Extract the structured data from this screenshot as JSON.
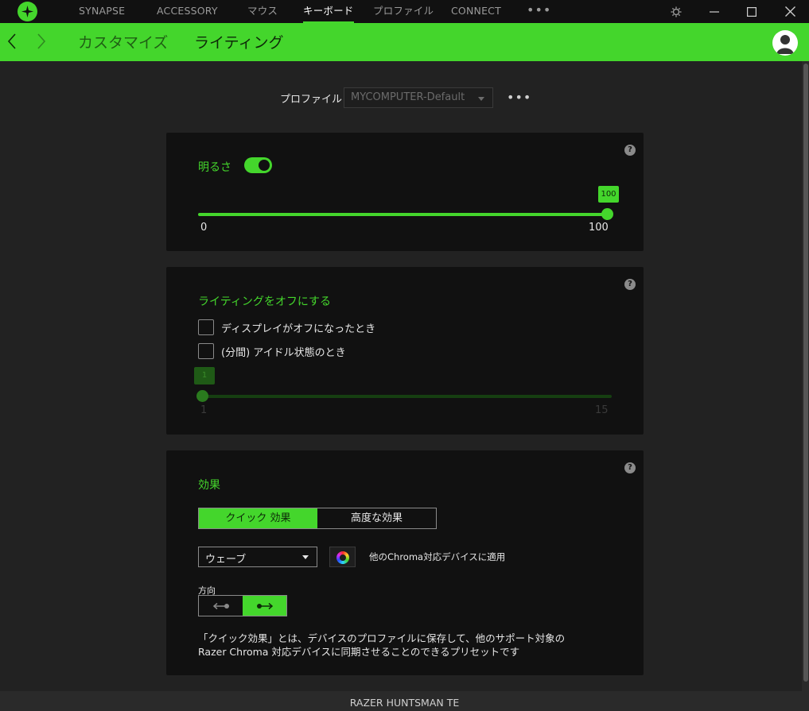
{
  "topbar": {
    "nav": [
      {
        "label": "SYNAPSE",
        "active": false
      },
      {
        "label": "ACCESSORY",
        "active": false
      },
      {
        "label": "マウス",
        "active": false
      },
      {
        "label": "キーボード",
        "active": true
      },
      {
        "label": "プロファイル",
        "active": false
      },
      {
        "label": "CONNECT",
        "active": false
      }
    ],
    "more": "•••"
  },
  "header": {
    "tabs": {
      "customize": "カスタマイズ",
      "lighting": "ライティング"
    }
  },
  "profile": {
    "label": "プロファイル",
    "value": "MYCOMPUTER-Default",
    "more": "•••"
  },
  "brightness": {
    "title": "明るさ",
    "enabled": true,
    "value": "100",
    "min": "0",
    "max": "100"
  },
  "lighting_off": {
    "title": "ライティングをオフにする",
    "options": [
      {
        "label": "ディスプレイがオフになったとき",
        "checked": false
      },
      {
        "label": "(分間) アイドル状態のとき",
        "checked": false
      }
    ],
    "idle_value": "1",
    "idle_min": "1",
    "idle_max": "15"
  },
  "effects": {
    "title": "効果",
    "tabs": {
      "quick": "クイック 効果",
      "advanced": "高度な効果"
    },
    "selected_effect": "ウェーブ",
    "chroma_apply": "他のChroma対応デバイスに適用",
    "direction_label": "方向",
    "description": "「クイック効果」とは、デバイスのプロファイルに保存して、他のサポート対象の Razer Chroma 対応デバイスに同期させることのできるプリセットです"
  },
  "help": "?",
  "footer": {
    "device": "RAZER HUNTSMAN TE"
  },
  "colors": {
    "accent": "#44d62c",
    "background": "#222222",
    "panel": "#111111"
  }
}
